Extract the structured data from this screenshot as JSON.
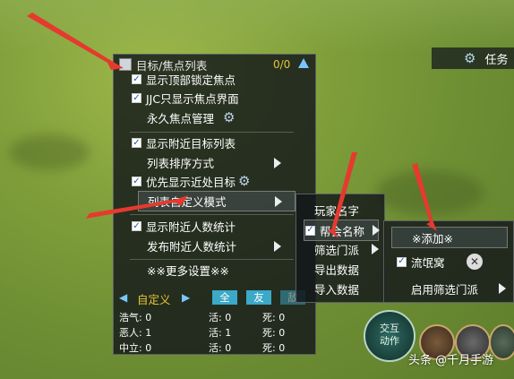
{
  "target_panel": {
    "title": "目标/焦点列表",
    "count": "0/0",
    "items": [
      {
        "label": "显示顶部锁定焦点",
        "checked": true
      },
      {
        "label": "JJC只显示焦点界面",
        "checked": true
      },
      {
        "label": "永久焦点管理"
      },
      {
        "label": "显示附近目标列表",
        "checked": true
      },
      {
        "label": "列表排序方式"
      },
      {
        "label": "优先显示近处目标",
        "checked": true
      },
      {
        "label": "列表自定义模式"
      },
      {
        "label": "显示附近人数统计",
        "checked": true
      },
      {
        "label": "发布附近人数统计"
      },
      {
        "label": "※※更多设置※※"
      }
    ],
    "filter": {
      "current": "自定义",
      "tabs": [
        "全",
        "友",
        "敌"
      ]
    },
    "stats": [
      [
        "浩气: 0",
        "活: 0",
        "死: 0"
      ],
      [
        "恶人: 1",
        "活: 1",
        "死: 0"
      ],
      [
        "中立: 0",
        "活: 0",
        "死: 0"
      ]
    ]
  },
  "submenu_custom_mode": {
    "items": [
      {
        "label": "玩家名字"
      },
      {
        "label": "帮会名称",
        "checked": true
      },
      {
        "label": "筛选门派"
      },
      {
        "label": "导出数据"
      },
      {
        "label": "导入数据"
      }
    ]
  },
  "submenu_guild": {
    "items": [
      {
        "label": "※添加※"
      },
      {
        "label": "流氓窝",
        "checked": true
      },
      {
        "label": "启用筛选门派"
      }
    ]
  },
  "task_panel": {
    "label": "任务"
  },
  "action_button": {
    "label_line1": "交互",
    "label_line2": "动作"
  },
  "watermark": "头条 @千月手游",
  "colors": {
    "accent_blue": "#3ba9c7",
    "count_yellow": "#e5c43a",
    "annotation_red": "#e53a2e"
  }
}
